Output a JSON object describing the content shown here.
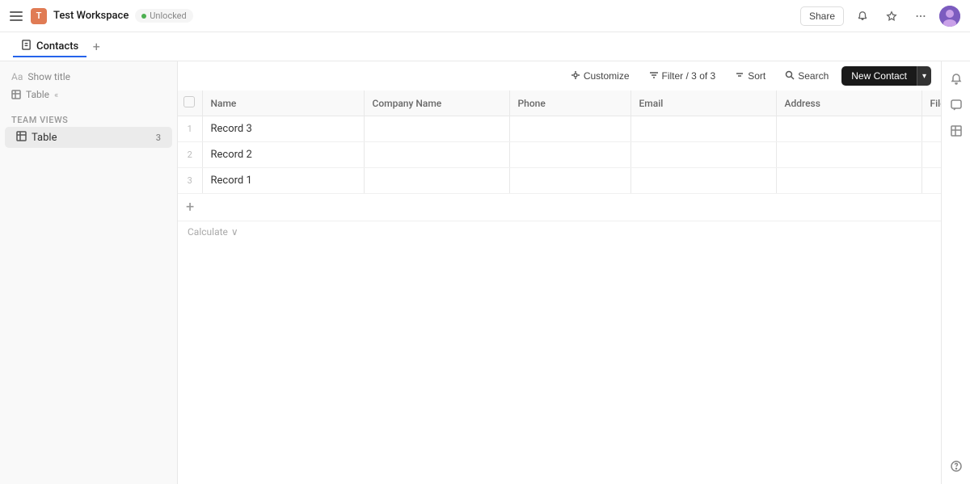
{
  "topbar": {
    "menu_label": "menu",
    "workspace_initial": "T",
    "workspace_title": "Test Workspace",
    "unlock_label": "Unlocked",
    "share_label": "Share",
    "more_label": "more options"
  },
  "tabs": [
    {
      "id": "contacts",
      "label": "Contacts",
      "active": true
    }
  ],
  "tab_add_label": "+",
  "sidebar": {
    "show_title_label": "Show title",
    "team_views_label": "Team views",
    "table_view_label": "Table",
    "table_chevron": "«",
    "table_item_label": "Table",
    "table_item_count": "3"
  },
  "toolbar": {
    "customize_label": "Customize",
    "filter_label": "Filter / 3 of 3",
    "sort_label": "Sort",
    "search_label": "Search",
    "new_contact_label": "New Contact",
    "chevron_label": "▾"
  },
  "table": {
    "columns": [
      {
        "id": "name",
        "label": "Name"
      },
      {
        "id": "company",
        "label": "Company Name"
      },
      {
        "id": "phone",
        "label": "Phone"
      },
      {
        "id": "email",
        "label": "Email"
      },
      {
        "id": "address",
        "label": "Address"
      },
      {
        "id": "files",
        "label": "Files"
      }
    ],
    "rows": [
      {
        "num": "1",
        "name": "Record 3",
        "company": "",
        "phone": "",
        "email": "",
        "address": "",
        "files": ""
      },
      {
        "num": "2",
        "name": "Record 2",
        "company": "",
        "phone": "",
        "email": "",
        "address": "",
        "files": ""
      },
      {
        "num": "3",
        "name": "Record 1",
        "company": "",
        "phone": "",
        "email": "",
        "address": "",
        "files": ""
      }
    ],
    "calculate_label": "Calculate",
    "calculate_chevron": "∨"
  }
}
